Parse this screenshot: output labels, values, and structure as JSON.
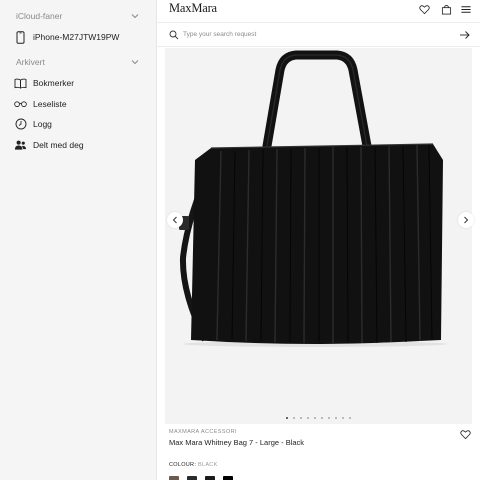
{
  "sidebar": {
    "sections": [
      {
        "label": "iCloud-faner"
      },
      {
        "label": "Arkivert"
      }
    ],
    "device_item": {
      "label": "iPhone-M27JTW19PW",
      "icon": "phone-icon"
    },
    "archived_items": [
      {
        "label": "Bokmerker",
        "icon": "book-icon"
      },
      {
        "label": "Leseliste",
        "icon": "glasses-icon"
      },
      {
        "label": "Logg",
        "icon": "clock-icon"
      },
      {
        "label": "Delt med deg",
        "icon": "people-icon"
      }
    ]
  },
  "header": {
    "logo": "MaxMara",
    "icons": [
      "heart-icon",
      "bag-icon",
      "menu-icon"
    ]
  },
  "search": {
    "placeholder": "Type your search request"
  },
  "gallery": {
    "image": "black tote bag",
    "dots_count": 10,
    "active_dot": 0
  },
  "product": {
    "brand": "MAXMARA ACCESSORI",
    "name": "Max Mara Whitney Bag 7 - Large - Black",
    "colour_label": "COLOUR:",
    "colour_value": "BLACK",
    "swatches": [
      "#6b5a4e",
      "#2b2b2b",
      "#1a1a1a",
      "#000000"
    ]
  },
  "colors": {
    "sidebar_bg": "#f5f5f5",
    "gallery_bg": "#f3f3f3",
    "text": "#1f1f1f",
    "muted": "#8a8a8a"
  }
}
